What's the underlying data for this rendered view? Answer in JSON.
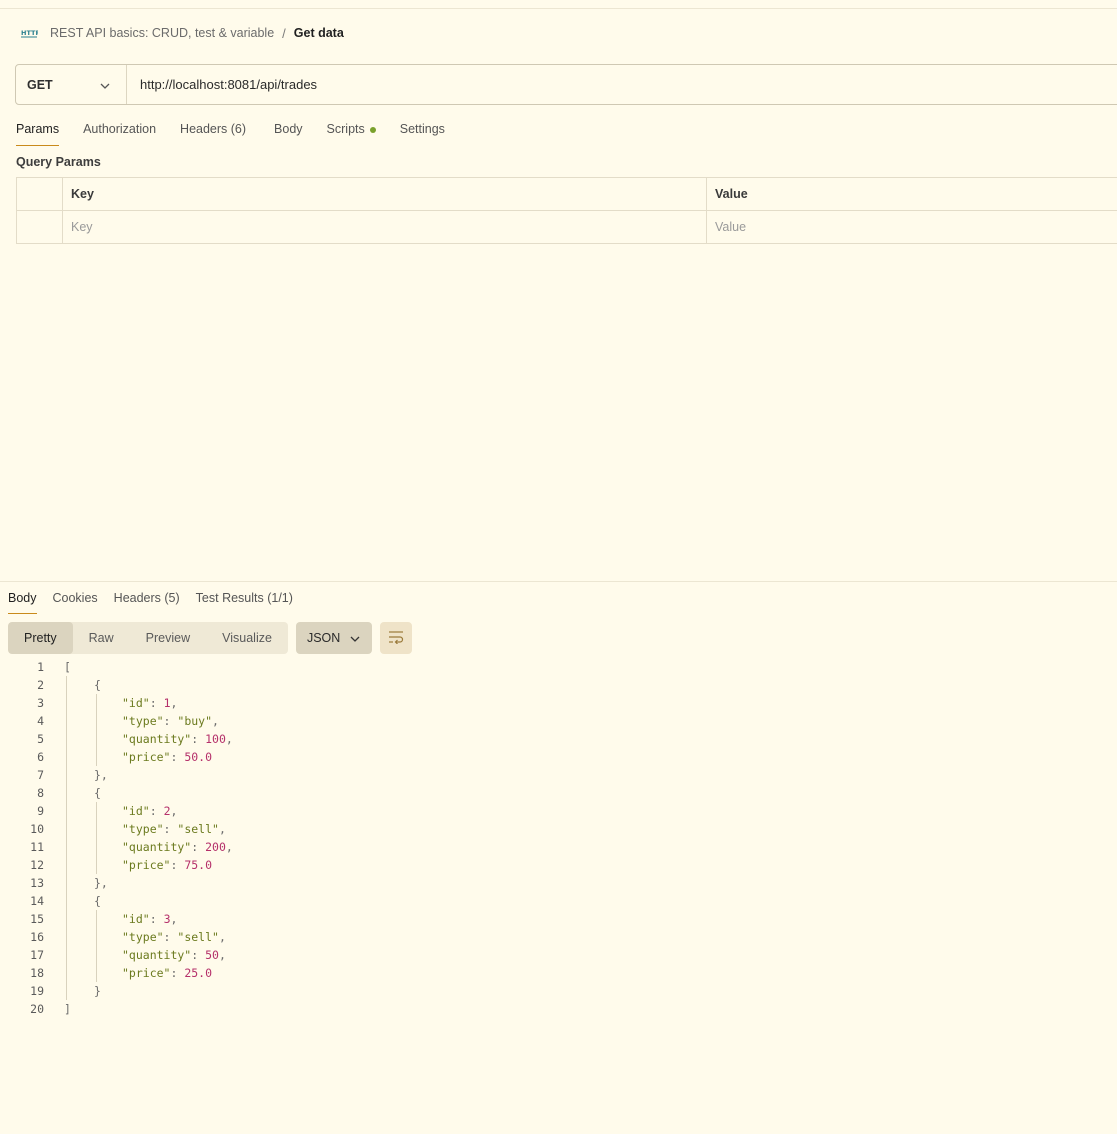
{
  "breadcrumb": {
    "icon": "http-icon",
    "parent": "REST API basics: CRUD, test & variable",
    "separator": "/",
    "current": "Get data"
  },
  "request": {
    "method": "GET",
    "url": "http://localhost:8081/api/trades"
  },
  "request_tabs": {
    "params": "Params",
    "authorization": "Authorization",
    "headers": "Headers (6)",
    "body": "Body",
    "scripts": "Scripts",
    "settings": "Settings"
  },
  "query_params": {
    "title": "Query Params",
    "col_key": "Key",
    "col_value": "Value",
    "key_placeholder": "Key",
    "value_placeholder": "Value"
  },
  "response_tabs": {
    "body": "Body",
    "cookies": "Cookies",
    "headers": "Headers (5)",
    "test_results": "Test Results (1/1)"
  },
  "view_modes": {
    "pretty": "Pretty",
    "raw": "Raw",
    "preview": "Preview",
    "visualize": "Visualize"
  },
  "format": "JSON",
  "colors": {
    "background": "#fffbeb",
    "accent_underline": "#c98a1b",
    "scripts_dot": "#7aa12b",
    "json_key": "#6b7a1e",
    "json_number": "#b5306a"
  },
  "code_lines": [
    {
      "n": "1",
      "text": "["
    },
    {
      "n": "2",
      "text": "{"
    },
    {
      "n": "3",
      "key": "\"id\"",
      "val": "1",
      "type": "num",
      "comma": ","
    },
    {
      "n": "4",
      "key": "\"type\"",
      "val": "\"buy\"",
      "type": "str",
      "comma": ","
    },
    {
      "n": "5",
      "key": "\"quantity\"",
      "val": "100",
      "type": "num",
      "comma": ","
    },
    {
      "n": "6",
      "key": "\"price\"",
      "val": "50.0",
      "type": "num",
      "comma": ""
    },
    {
      "n": "7",
      "text": "},"
    },
    {
      "n": "8",
      "text": "{"
    },
    {
      "n": "9",
      "key": "\"id\"",
      "val": "2",
      "type": "num",
      "comma": ","
    },
    {
      "n": "10",
      "key": "\"type\"",
      "val": "\"sell\"",
      "type": "str",
      "comma": ","
    },
    {
      "n": "11",
      "key": "\"quantity\"",
      "val": "200",
      "type": "num",
      "comma": ","
    },
    {
      "n": "12",
      "key": "\"price\"",
      "val": "75.0",
      "type": "num",
      "comma": ""
    },
    {
      "n": "13",
      "text": "},"
    },
    {
      "n": "14",
      "text": "{"
    },
    {
      "n": "15",
      "key": "\"id\"",
      "val": "3",
      "type": "num",
      "comma": ","
    },
    {
      "n": "16",
      "key": "\"type\"",
      "val": "\"sell\"",
      "type": "str",
      "comma": ","
    },
    {
      "n": "17",
      "key": "\"quantity\"",
      "val": "50",
      "type": "num",
      "comma": ","
    },
    {
      "n": "18",
      "key": "\"price\"",
      "val": "25.0",
      "type": "num",
      "comma": ""
    },
    {
      "n": "19",
      "text": "}"
    },
    {
      "n": "20",
      "text": "]"
    }
  ]
}
